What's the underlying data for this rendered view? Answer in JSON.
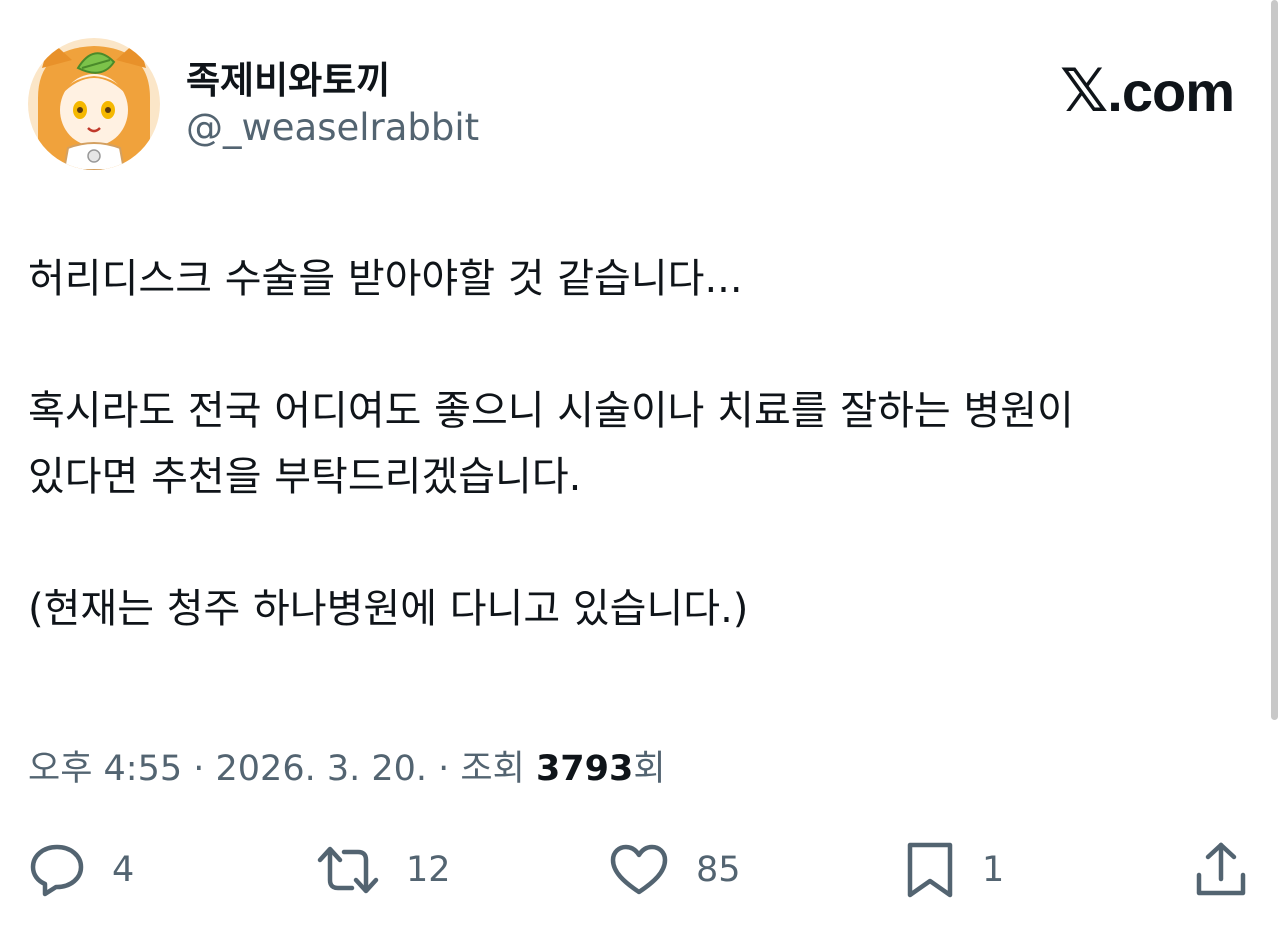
{
  "author": {
    "display_name": "족제비와토끼",
    "handle": "@_weaselrabbit",
    "avatar_icon": "fox-girl-avatar-icon"
  },
  "brand": {
    "logo_mark": "𝕏",
    "logo_text": ".com"
  },
  "tweet": {
    "line1": "허리디스크 수술을 받아야할 것 같습니다...",
    "line2": "혹시라도 전국 어디여도 좋으니 시술이나 치료를 잘하는 병원이",
    "line3": "있다면 추천을 부탁드리겠습니다.",
    "line4": "(현재는 청주 하나병원에 다니고 있습니다.)"
  },
  "meta": {
    "time": "오후 4:55",
    "separator": " · ",
    "date": "2026. 3. 20.",
    "views_label": "조회 ",
    "views_count": "3793",
    "views_suffix": "회"
  },
  "actions": {
    "reply": {
      "icon": "reply-icon",
      "count": "4"
    },
    "retweet": {
      "icon": "retweet-icon",
      "count": "12"
    },
    "like": {
      "icon": "heart-icon",
      "count": "85"
    },
    "bookmark": {
      "icon": "bookmark-icon",
      "count": "1"
    },
    "share": {
      "icon": "share-icon"
    }
  },
  "colors": {
    "text_primary": "#0f1419",
    "text_secondary": "#536471",
    "avatar_hair": "#f0a23c",
    "avatar_leaf": "#7cc24a"
  }
}
